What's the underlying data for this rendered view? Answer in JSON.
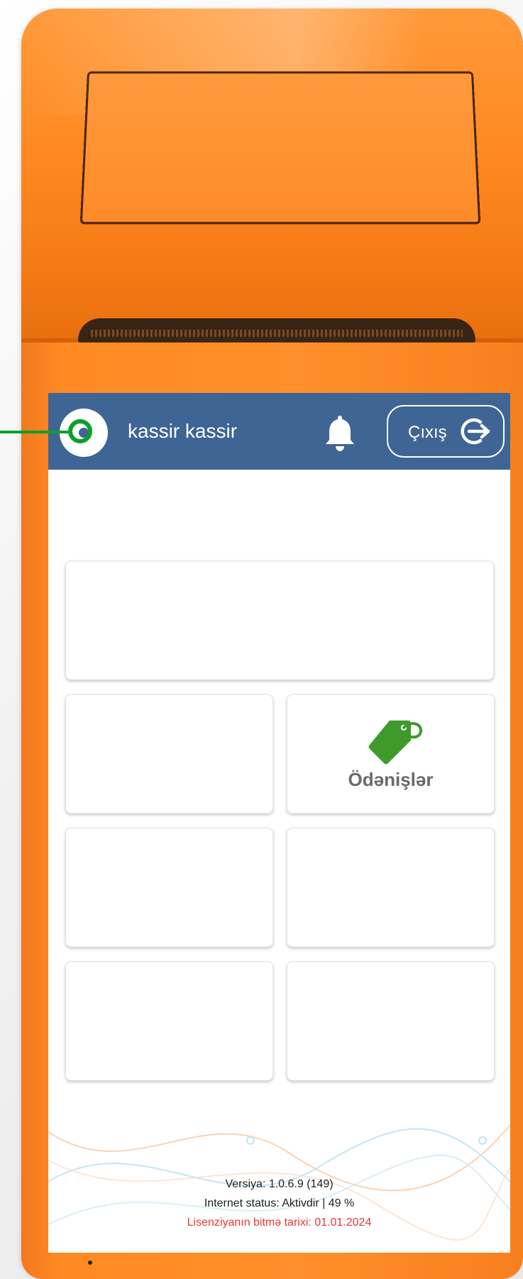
{
  "header": {
    "user_name": "kassir kassir",
    "logout_label": "Çıxış"
  },
  "tiles": {
    "payments_label": "Ödənişlər"
  },
  "footer": {
    "version": "Versiya: 1.0.6.9 (149)",
    "internet_status": "Internet status: Aktivdir | 49 %",
    "license_expiry": "Lisenziyanın bitmə tarixi: 01.01.2024"
  },
  "colors": {
    "header_bg": "#3f6594",
    "device_orange": "#ff8a24",
    "payments_icon": "#3f9a2b",
    "license_text": "#e53935",
    "annotation": "#0aa02c"
  },
  "icons": [
    "avatar-icon",
    "bell-icon",
    "logout-icon",
    "price-tag-icon"
  ]
}
